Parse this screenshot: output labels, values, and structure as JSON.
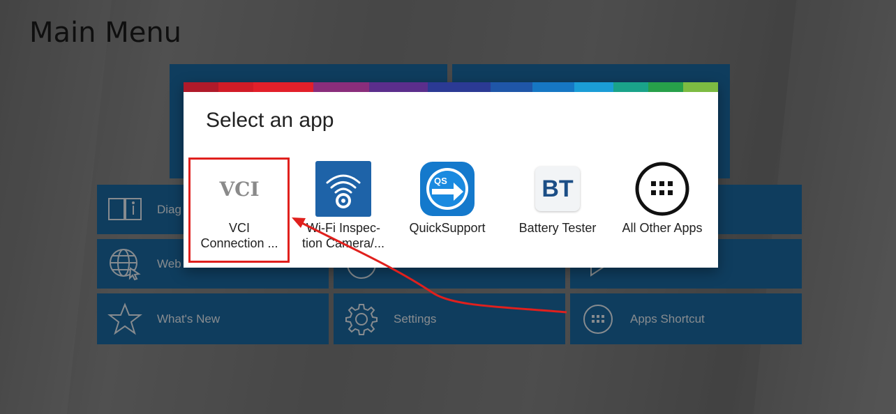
{
  "main_menu": {
    "title": "Main Menu",
    "tiles": [
      {
        "label": "Diag",
        "icon": "book-info-icon"
      },
      {
        "label": "Web",
        "icon": "globe-cursor-icon"
      },
      {
        "label": "What's New",
        "icon": "star-icon"
      },
      {
        "label": "Settings",
        "icon": "gear-icon"
      },
      {
        "label": "Apps Shortcut",
        "icon": "apps-grid-icon"
      }
    ]
  },
  "dialog": {
    "title": "Select an app",
    "apps": [
      {
        "label_line1": "VCI",
        "label_line2": "Connection ...",
        "icon_text": "VCI",
        "icon": "vci-icon"
      },
      {
        "label_line1": "Wi-Fi Inspec-",
        "label_line2": "tion Camera/...",
        "icon": "wifi-camera-icon"
      },
      {
        "label_line1": "QuickSupport",
        "label_line2": "",
        "icon_text": "QS",
        "icon": "quicksupport-icon"
      },
      {
        "label_line1": "Battery Tester",
        "label_line2": "",
        "icon_text": "BT",
        "icon": "battery-tester-icon"
      },
      {
        "label_line1": "All Other Apps",
        "label_line2": "",
        "icon": "all-apps-icon"
      }
    ]
  },
  "colors": {
    "tile": "#1a6aa2",
    "highlight": "#e0201d",
    "arrow": "#e0201d"
  }
}
